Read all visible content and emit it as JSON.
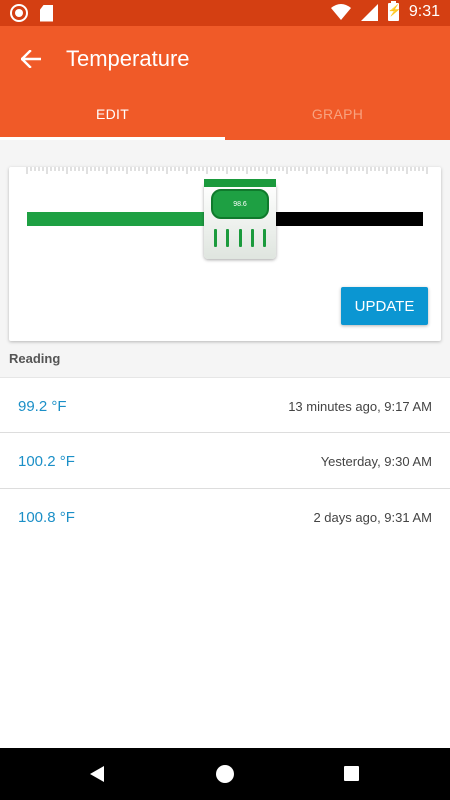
{
  "status_bar": {
    "time": "9:31"
  },
  "app_bar": {
    "title": "Temperature"
  },
  "tabs": [
    {
      "label": "EDIT",
      "active": true
    },
    {
      "label": "GRAPH",
      "active": false
    }
  ],
  "thermometer": {
    "value": "98.6",
    "slider_fraction": 0.5
  },
  "card": {
    "update_label": "UPDATE"
  },
  "section": {
    "label": "Reading"
  },
  "readings": [
    {
      "value": "99.2 °F",
      "time": "13 minutes ago, 9:17 AM"
    },
    {
      "value": "100.2 °F",
      "time": "Yesterday, 9:30 AM"
    },
    {
      "value": "100.8 °F",
      "time": "2 days ago, 9:31 AM"
    }
  ],
  "colors": {
    "app_bar": "#f05a28",
    "status_bar": "#d43f12",
    "accent_green": "#1ea043",
    "button_blue": "#0b96d2",
    "reading_blue": "#1b8fc7"
  }
}
